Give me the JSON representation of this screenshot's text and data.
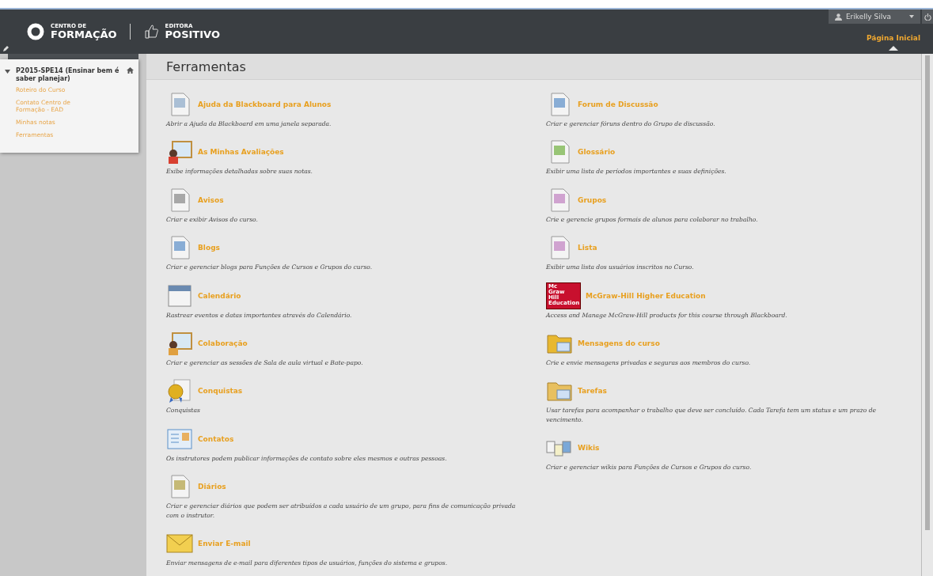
{
  "header": {
    "logo_left": [
      "CENTRO DE",
      "FORMAÇÃO"
    ],
    "logo_right": [
      "EDITORA",
      "POSITIVO"
    ],
    "user": "Erikelly Silva",
    "tabs": [
      {
        "label": "Página Inicial",
        "selected": true
      }
    ]
  },
  "sidebar": {
    "course": {
      "title": "P2015-SPE14 (Ensinar bem é saber planejar)",
      "expanded": true
    },
    "links": [
      "Roteiro do Curso",
      "Contato Centro de Formação - EAD",
      "Minhas notas",
      "Ferramentas"
    ]
  },
  "page": {
    "title": "Ferramentas"
  },
  "columns": [
    [
      {
        "title": "Ajuda da Blackboard para Alunos",
        "description": "Abrir a Ajuda da Blackboard em uma janela separada."
      },
      {
        "title": "As Minhas Avaliações",
        "description": "Exibe informações detalhadas sobre suas notas."
      },
      {
        "title": "Avisos",
        "description": "Criar e exibir Avisos do curso."
      },
      {
        "title": "Blogs",
        "description": "Criar e gerenciar blogs para Funções de Cursos e Grupos do curso."
      },
      {
        "title": "Calendário",
        "description": "Rastrear eventos e datas importantes através do Calendário."
      },
      {
        "title": "Colaboração",
        "description": "Criar e gerenciar as sessões de Sala de aula virtual e Bate-papo."
      },
      {
        "title": "Conquistas",
        "description": "Conquistas"
      },
      {
        "title": "Contatos",
        "description": "Os instrutores podem publicar informações de contato sobre eles mesmos e outras pessoas."
      },
      {
        "title": "Diários",
        "description": "Criar e gerenciar diários que podem ser atribuídos a cada usuário de um grupo, para fins de comunicação privada com o instrutor."
      },
      {
        "title": "Enviar E-mail",
        "description": "Enviar mensagens de e-mail para diferentes tipos de usuários, funções do sistema e grupos."
      }
    ],
    [
      {
        "title": "Forum de Discussão",
        "description": "Criar e gerenciar fóruns dentro do Grupo de discussão."
      },
      {
        "title": "Glossário",
        "description": "Exibir uma lista de períodos importantes e suas definições."
      },
      {
        "title": "Grupos",
        "description": "Crie e gerencie grupos formais de alunos para colaborar no trabalho."
      },
      {
        "title": "Lista",
        "description": "Exibir uma lista dos usuários inscritos no Curso."
      },
      {
        "title": "McGraw-Hill Higher Education",
        "description": "Access and Manage McGraw-Hill products for this course through Blackboard.",
        "badge_lines": [
          "Mc",
          "Graw",
          "Hill",
          "Education"
        ]
      },
      {
        "title": "Mensagens do curso",
        "description": "Crie e envie mensagens privadas e seguras aos membros do curso."
      },
      {
        "title": "Tarefas",
        "description": "Usar tarefas para acompanhar o trabalho que deve ser concluído. Cada Tarefa tem um status e um prazo de vencimento."
      },
      {
        "title": "Wikis",
        "description": "Criar e gerenciar wikis para Funções de Cursos e Grupos do curso."
      }
    ]
  ]
}
